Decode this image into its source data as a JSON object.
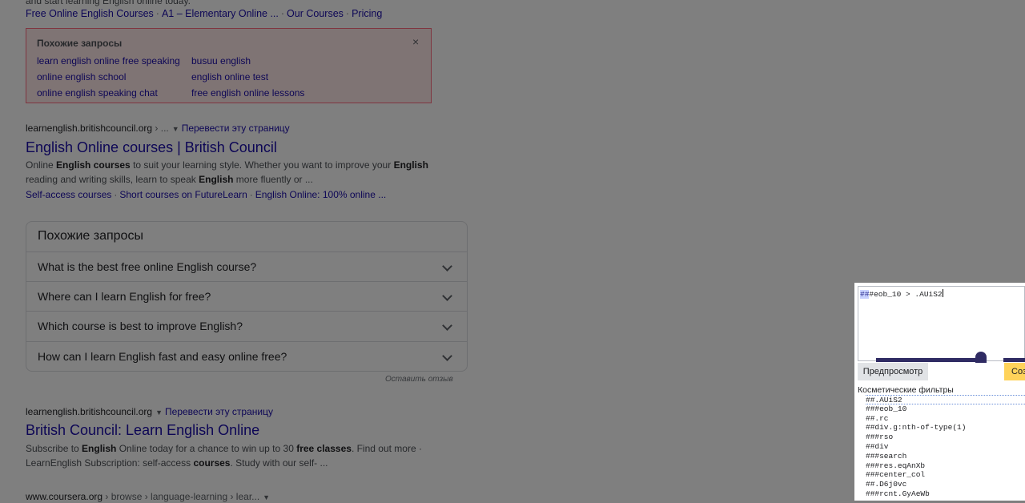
{
  "search_page": {
    "top_partial_snippet": "and start learning English online today.",
    "top_sitelinks": [
      "Free Online English Courses",
      "A1 – Elementary Online ...",
      "Our Courses",
      "Pricing"
    ],
    "highlight_box": {
      "title": "Похожие запросы",
      "close": "×",
      "links": [
        "learn english online free speaking",
        "busuu english",
        "online english school",
        "english online test",
        "online english speaking chat",
        "free english online lessons"
      ]
    },
    "result1": {
      "domain": "learnenglish.britishcouncil.org",
      "path": " › ...",
      "translate": "Перевести эту страницу",
      "title": "English Online courses | British Council",
      "snippet_segments": [
        {
          "t": "Online ",
          "b": false
        },
        {
          "t": "English courses",
          "b": true
        },
        {
          "t": " to suit your learning style. Whether you want to improve your ",
          "b": false
        },
        {
          "t": "English",
          "b": true
        },
        {
          "t": " reading and writing skills, learn to speak ",
          "b": false
        },
        {
          "t": "English",
          "b": true
        },
        {
          "t": " more fluently or ...",
          "b": false
        }
      ],
      "sitelinks": [
        "Self-access courses",
        "Short courses on FutureLearn",
        "English Online: 100% online ..."
      ]
    },
    "people_also_ask": {
      "title": "Похожие запросы",
      "questions": [
        "What is the best free online English course?",
        "Where can I learn English for free?",
        "Which course is best to improve English?",
        "How can I learn English fast and easy online free?"
      ],
      "feedback": "Оставить отзыв"
    },
    "result2": {
      "domain": "learnenglish.britishcouncil.org",
      "translate": "Перевести эту страницу",
      "title": "British Council: Learn English Online",
      "snippet_line1": [
        {
          "t": "Subscribe to ",
          "b": false
        },
        {
          "t": "English",
          "b": true
        },
        {
          "t": " Online today for a chance to win up to 30 ",
          "b": false
        },
        {
          "t": "free classes",
          "b": true
        },
        {
          "t": ". Find out more ·",
          "b": false
        }
      ],
      "snippet_line2": [
        {
          "t": "LearnEnglish Subscription: self-access ",
          "b": false
        },
        {
          "t": "courses",
          "b": true
        },
        {
          "t": ". Study with our self- ...",
          "b": false
        }
      ]
    },
    "result3": {
      "domain": "www.coursera.org",
      "path": " › browse › language-learning › lear..."
    }
  },
  "filter_panel": {
    "rule_prefix": "##",
    "rule_rest": "#eob_10 > .AUiS2",
    "preview_label": "Предпросмотр",
    "create_label": "Создать",
    "cosmetic_label": "Косметические фильтры",
    "filters": [
      "##.AUiS2",
      "###eob_10",
      "##.rc",
      "##div.g:nth-of-type(1)",
      "###rso",
      "##div",
      "###search",
      "###res.eqAnXb",
      "###center_col",
      "##.D6j0vc",
      "###rcnt.GyAeWb"
    ],
    "selected_filter_index": 0
  },
  "colors": {
    "link": "#1a0dab",
    "highlight_bg": "#ffe8e8",
    "highlight_border": "#ff6b81",
    "overlay": "rgba(0,0,0,0.5)",
    "create_button": "#ffd35a",
    "slider": "#2f2b63"
  }
}
